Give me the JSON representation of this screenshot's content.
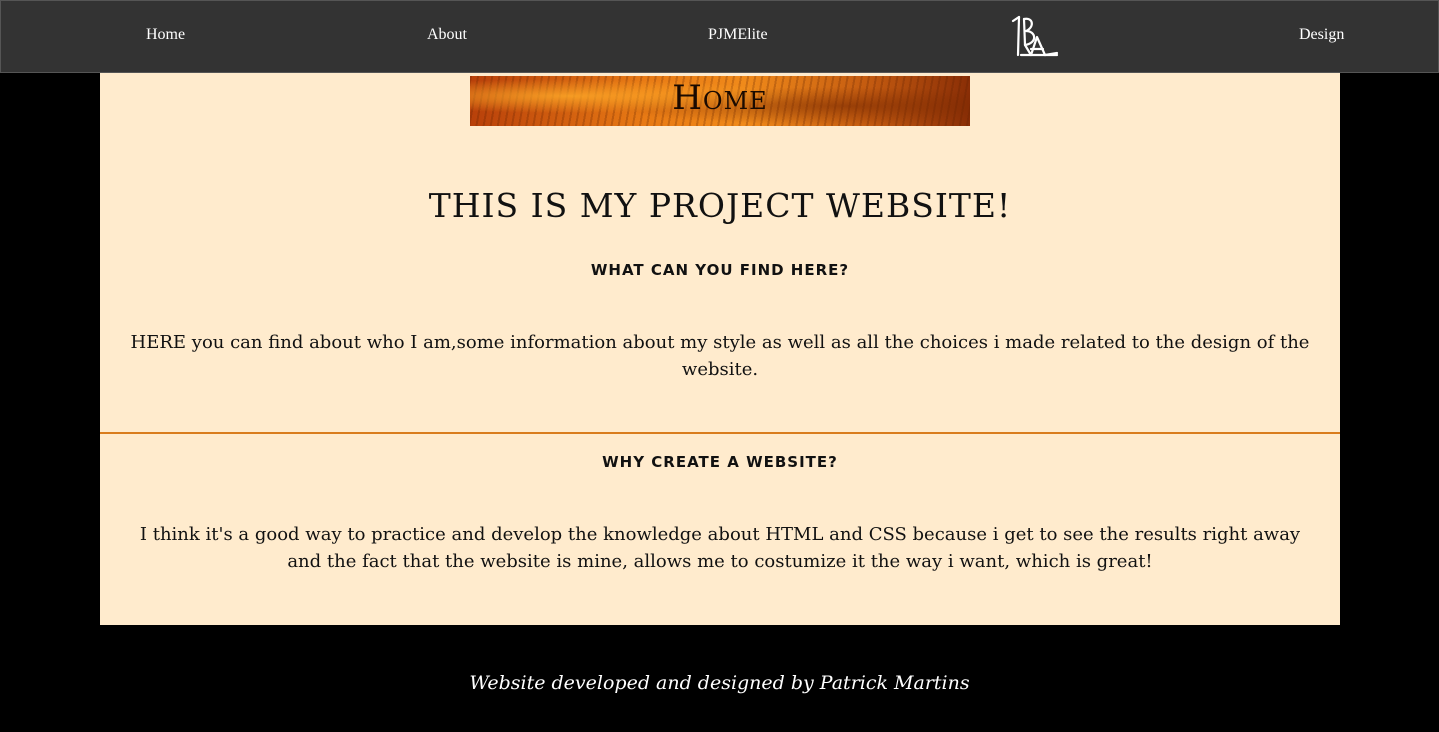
{
  "nav": {
    "home": "Home",
    "about": "About",
    "pjmelite": "PJMElite",
    "logo_icon": "iba-logo-icon",
    "design": "Design"
  },
  "banner": {
    "title": "Home"
  },
  "main": {
    "heading": "THIS IS MY PROJECT WEBSITE!",
    "section1": {
      "heading": "WHAT CAN YOU FIND HERE?",
      "text": "HERE you can find about who I am,some information about my style as well as all the choices i made related to the design of the website."
    },
    "section2": {
      "heading": "WHY CREATE A WEBSITE?",
      "text": "I think it's a good way to practice and develop the knowledge about HTML and CSS because i get to see the results right away and the fact that the website is mine, allows me to costumize it the way i want, which is great!"
    }
  },
  "footer": {
    "text": "Website developed and designed by Patrick Martins"
  },
  "colors": {
    "navbar": "#333333",
    "content_bg": "#ffebcd",
    "divider": "#d97c1c",
    "page_bg": "#000000"
  }
}
